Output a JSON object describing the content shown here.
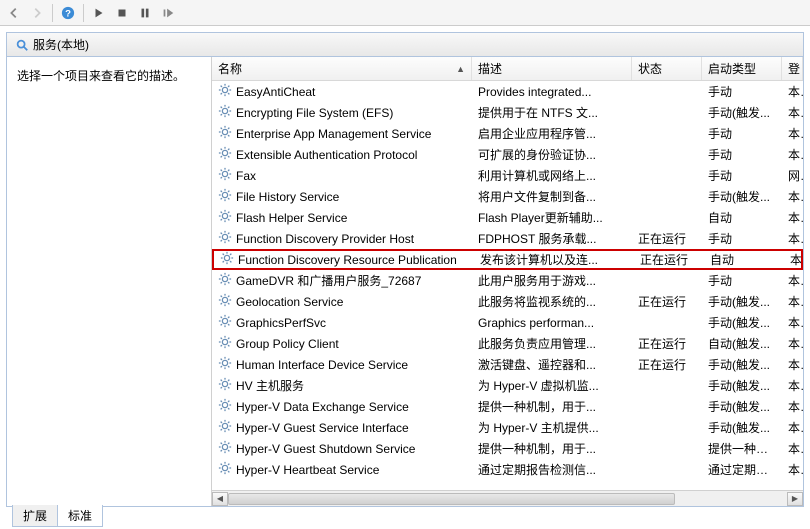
{
  "toolbar": {
    "buttons": [
      "back",
      "fwd",
      "help",
      "play",
      "stop",
      "pause",
      "restart"
    ]
  },
  "tab_title": "服务(本地)",
  "left_hint": "选择一个项目来查看它的描述。",
  "columns": {
    "name": "名称",
    "desc": "描述",
    "status": "状态",
    "start": "启动类型",
    "logon": "登"
  },
  "services": [
    {
      "name": "EasyAntiCheat",
      "desc": "Provides integrated...",
      "status": "",
      "start": "手动",
      "logon": "本"
    },
    {
      "name": "Encrypting File System (EFS)",
      "desc": "提供用于在 NTFS 文...",
      "status": "",
      "start": "手动(触发...",
      "logon": "本"
    },
    {
      "name": "Enterprise App Management Service",
      "desc": "启用企业应用程序管...",
      "status": "",
      "start": "手动",
      "logon": "本"
    },
    {
      "name": "Extensible Authentication Protocol",
      "desc": "可扩展的身份验证协...",
      "status": "",
      "start": "手动",
      "logon": "本"
    },
    {
      "name": "Fax",
      "desc": "利用计算机或网络上...",
      "status": "",
      "start": "手动",
      "logon": "网"
    },
    {
      "name": "File History Service",
      "desc": "将用户文件复制到备...",
      "status": "",
      "start": "手动(触发...",
      "logon": "本"
    },
    {
      "name": "Flash Helper Service",
      "desc": "Flash Player更新辅助...",
      "status": "",
      "start": "自动",
      "logon": "本"
    },
    {
      "name": "Function Discovery Provider Host",
      "desc": "FDPHOST 服务承载...",
      "status": "正在运行",
      "start": "手动",
      "logon": "本"
    },
    {
      "name": "Function Discovery Resource Publication",
      "desc": "发布该计算机以及连...",
      "status": "正在运行",
      "start": "自动",
      "logon": "本",
      "highlight": true
    },
    {
      "name": "GameDVR 和广播用户服务_72687",
      "desc": "此用户服务用于游戏...",
      "status": "",
      "start": "手动",
      "logon": "本"
    },
    {
      "name": "Geolocation Service",
      "desc": "此服务将监视系统的...",
      "status": "正在运行",
      "start": "手动(触发...",
      "logon": "本"
    },
    {
      "name": "GraphicsPerfSvc",
      "desc": "Graphics performan...",
      "status": "",
      "start": "手动(触发...",
      "logon": "本"
    },
    {
      "name": "Group Policy Client",
      "desc": "此服务负责应用管理...",
      "status": "正在运行",
      "start": "自动(触发...",
      "logon": "本"
    },
    {
      "name": "Human Interface Device Service",
      "desc": "激活键盘、遥控器和...",
      "status": "正在运行",
      "start": "手动(触发...",
      "logon": "本"
    },
    {
      "name": "HV 主机服务",
      "desc": "为 Hyper-V 虚拟机监...",
      "status": "",
      "start": "手动(触发...",
      "logon": "本"
    },
    {
      "name": "Hyper-V Data Exchange Service",
      "desc": "提供一种机制，用于...",
      "status": "",
      "start": "手动(触发...",
      "logon": "本"
    },
    {
      "name": "Hyper-V Guest Service Interface",
      "desc": "为 Hyper-V 主机提供...",
      "status": "",
      "start": "手动(触发...",
      "logon": "本"
    },
    {
      "name": "Hyper-V Guest Shutdown Service",
      "desc": "提供一种机制，用于...",
      "status": "",
      "start": "提供一种机动(触发...",
      "logon": "本"
    },
    {
      "name": "Hyper-V Heartbeat Service",
      "desc": "通过定期报告检测信...",
      "status": "",
      "start": "通过定期报告动(触...",
      "logon": "本"
    }
  ],
  "bottom_tabs": {
    "expand": "扩展",
    "standard": "标准"
  }
}
